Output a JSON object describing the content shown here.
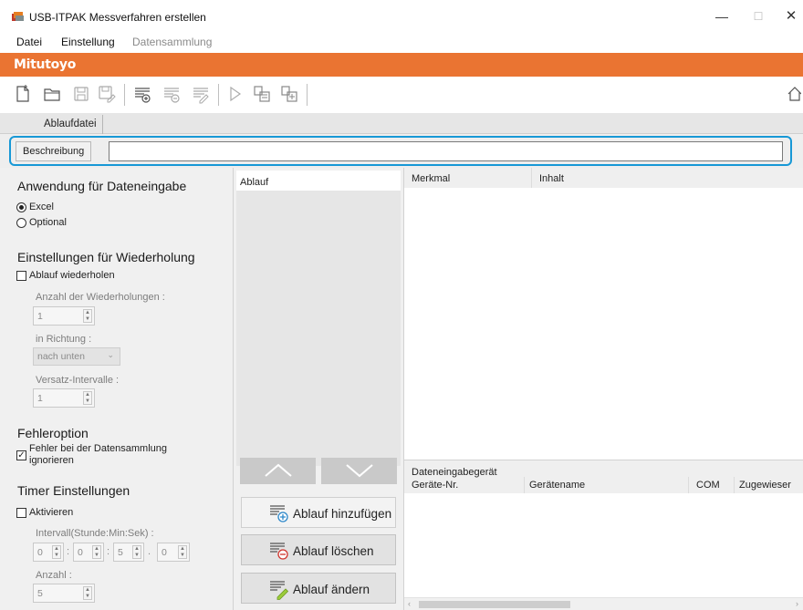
{
  "window": {
    "title": "USB-ITPAK Messverfahren erstellen",
    "minimize_glyph": "—",
    "maximize_glyph": "☐",
    "close_glyph": "✕"
  },
  "menu": {
    "items": [
      {
        "label": "Datei",
        "enabled": true
      },
      {
        "label": "Einstellung",
        "enabled": true
      },
      {
        "label": "Datensammlung",
        "enabled": false
      }
    ]
  },
  "brand": {
    "logo_text": "Mitutoyo",
    "color": "#ea7432"
  },
  "toolbar": {
    "icons": [
      "new-file-icon",
      "open-folder-icon",
      "save-icon",
      "save-as-icon",
      "add-procedure-icon",
      "remove-procedure-icon",
      "edit-procedure-icon",
      "run-icon",
      "copy-device-icon",
      "paste-device-icon",
      "home-icon"
    ]
  },
  "tabs": [
    {
      "label": "Ablaufdatei"
    }
  ],
  "description": {
    "label": "Beschreibung",
    "value": "",
    "highlight_color": "#1798d6"
  },
  "left": {
    "input_app": {
      "heading": "Anwendung für Dateneingabe",
      "options": [
        {
          "label": "Excel",
          "checked": true
        },
        {
          "label": "Optional",
          "checked": false
        }
      ]
    },
    "repeat": {
      "heading": "Einstellungen für Wiederholung",
      "checkbox_label": "Ablauf wiederholen",
      "checked": false,
      "count_label": "Anzahl der Wiederholungen :",
      "count_value": "1",
      "direction_label": "in Richtung :",
      "direction_value": "nach unten",
      "offset_label": "Versatz-Intervalle :",
      "offset_value": "1"
    },
    "error": {
      "heading": "Fehleroption",
      "checkbox_label_line1": "Fehler bei der Datensammlung",
      "checkbox_label_line2": "ignorieren",
      "checked": true
    },
    "timer": {
      "heading": "Timer Einstellungen",
      "checkbox_label": "Aktivieren",
      "checked": false,
      "interval_label": "Intervall(Stunde:Min:Sek) :",
      "hours": "0",
      "minutes": "0",
      "seconds": "5",
      "tenths": "0",
      "sep1": ":",
      "sep2": ":",
      "sep3": ".",
      "count_label": "Anzahl :",
      "count_value": "5"
    }
  },
  "middle": {
    "list_header": "Ablauf",
    "buttons": {
      "add": "Ablauf hinzufügen",
      "delete": "Ablauf löschen",
      "edit": "Ablauf ändern"
    }
  },
  "right": {
    "grid_columns": [
      "Merkmal",
      "Inhalt"
    ],
    "devices": {
      "group_title": "Dateneingabegerät",
      "columns": [
        "Geräte-Nr.",
        "Gerätename",
        "COM",
        "Zugewieser"
      ]
    }
  }
}
